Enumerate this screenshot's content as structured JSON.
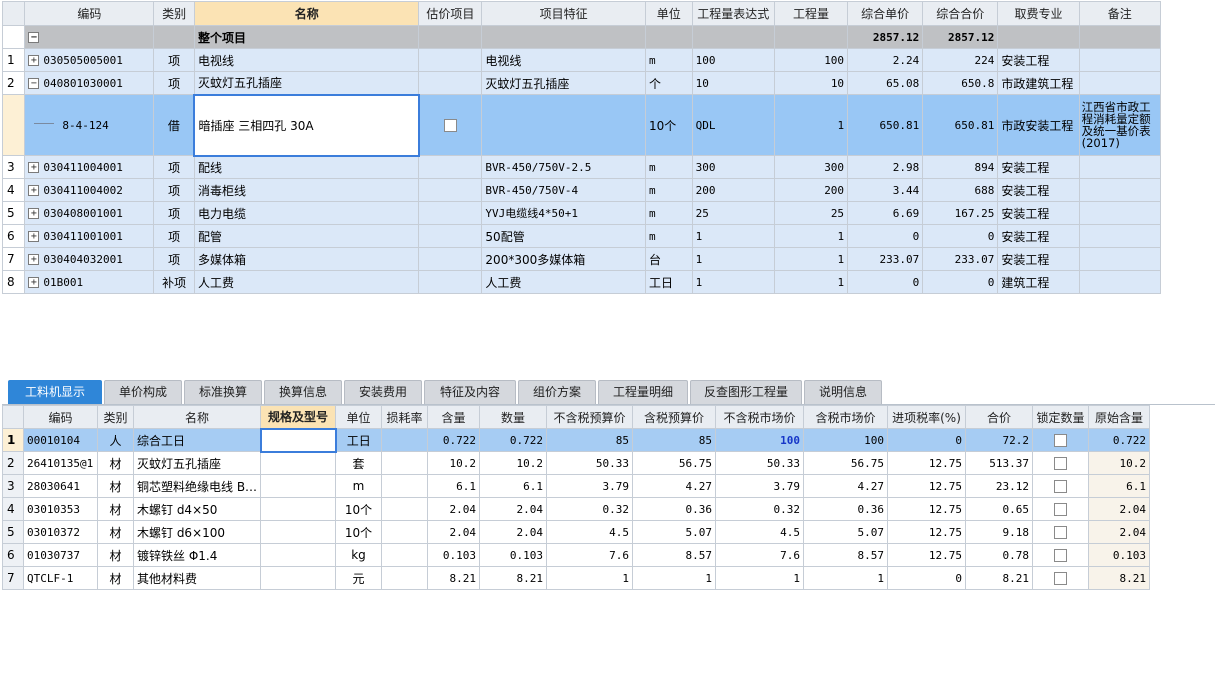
{
  "top": {
    "headers": [
      "编码",
      "类别",
      "名称",
      "估价项目",
      "项目特征",
      "单位",
      "工程量表达式",
      "工程量",
      "综合单价",
      "综合合价",
      "取费专业",
      "备注"
    ],
    "total": {
      "label": "整个项目",
      "unit_price": "2857.12",
      "total_price": "2857.12"
    },
    "rows": [
      {
        "idx": "1",
        "code": "030505005001",
        "type": "项",
        "name": "电视线",
        "feature": "电视线",
        "unit": "m",
        "expr": "100",
        "qty": "100",
        "price": "2.24",
        "total": "224",
        "fee": "安装工程",
        "note": ""
      },
      {
        "idx": "2",
        "code": "040801030001",
        "type": "项",
        "name": "灭蚊灯五孔插座",
        "feature": "灭蚊灯五孔插座",
        "unit": "个",
        "expr": "10",
        "qty": "10",
        "price": "65.08",
        "total": "650.8",
        "fee": "市政建筑工程",
        "note": ""
      }
    ],
    "sub": {
      "code": "8-4-124",
      "type": "借",
      "name": "暗插座 三相四孔 30A",
      "unit": "10个",
      "expr": "QDL",
      "qty": "1",
      "price": "650.81",
      "total": "650.81",
      "fee": "市政安装工程",
      "note": "江西省市政工程消耗量定额及统一基价表(2017)"
    },
    "rows2": [
      {
        "idx": "3",
        "code": "030411004001",
        "type": "项",
        "name": "配线",
        "feature": "BVR-450/750V-2.5",
        "unit": "m",
        "expr": "300",
        "qty": "300",
        "price": "2.98",
        "total": "894",
        "fee": "安装工程",
        "note": ""
      },
      {
        "idx": "4",
        "code": "030411004002",
        "type": "项",
        "name": "消毒柜线",
        "feature": "BVR-450/750V-4",
        "unit": "m",
        "expr": "200",
        "qty": "200",
        "price": "3.44",
        "total": "688",
        "fee": "安装工程",
        "note": ""
      },
      {
        "idx": "5",
        "code": "030408001001",
        "type": "项",
        "name": "电力电缆",
        "feature": "YVJ电缆线4*50+1",
        "unit": "m",
        "expr": "25",
        "qty": "25",
        "price": "6.69",
        "total": "167.25",
        "fee": "安装工程",
        "note": ""
      },
      {
        "idx": "6",
        "code": "030411001001",
        "type": "项",
        "name": "配管",
        "feature": "50配管",
        "unit": "m",
        "expr": "1",
        "qty": "1",
        "price": "0",
        "total": "0",
        "fee": "安装工程",
        "note": ""
      },
      {
        "idx": "7",
        "code": "030404032001",
        "type": "项",
        "name": "多媒体箱",
        "feature": "200*300多媒体箱",
        "unit": "台",
        "expr": "1",
        "qty": "1",
        "price": "233.07",
        "total": "233.07",
        "fee": "安装工程",
        "note": ""
      },
      {
        "idx": "8",
        "code": "01B001",
        "type": "补项",
        "name": "人工费",
        "feature": "人工费",
        "unit": "工日",
        "expr": "1",
        "qty": "1",
        "price": "0",
        "total": "0",
        "fee": "建筑工程",
        "note": ""
      }
    ]
  },
  "tabs": [
    "工料机显示",
    "单价构成",
    "标准换算",
    "换算信息",
    "安装费用",
    "特征及内容",
    "组价方案",
    "工程量明细",
    "反查图形工程量",
    "说明信息"
  ],
  "bottom": {
    "headers": [
      "编码",
      "类别",
      "名称",
      "规格及型号",
      "单位",
      "损耗率",
      "含量",
      "数量",
      "不含税预算价",
      "含税预算价",
      "不含税市场价",
      "含税市场价",
      "进项税率(%)",
      "合价",
      "锁定数量",
      "原始含量"
    ],
    "rows": [
      {
        "idx": "1",
        "code": "00010104",
        "type": "人",
        "name": "综合工日",
        "spec": "",
        "unit": "工日",
        "loss": "",
        "content": "0.722",
        "qty": "0.722",
        "p1": "85",
        "p2": "85",
        "p3": "100",
        "p4": "100",
        "tax": "0",
        "total": "72.2",
        "orig": "0.722"
      },
      {
        "idx": "2",
        "code": "26410135@1",
        "type": "材",
        "name": "灭蚊灯五孔插座",
        "spec": "",
        "unit": "套",
        "loss": "",
        "content": "10.2",
        "qty": "10.2",
        "p1": "50.33",
        "p2": "56.75",
        "p3": "50.33",
        "p4": "56.75",
        "tax": "12.75",
        "total": "513.37",
        "orig": "10.2"
      },
      {
        "idx": "3",
        "code": "28030641",
        "type": "材",
        "name": "铜芯塑料绝缘电线 B…",
        "spec": "",
        "unit": "m",
        "loss": "",
        "content": "6.1",
        "qty": "6.1",
        "p1": "3.79",
        "p2": "4.27",
        "p3": "3.79",
        "p4": "4.27",
        "tax": "12.75",
        "total": "23.12",
        "orig": "6.1"
      },
      {
        "idx": "4",
        "code": "03010353",
        "type": "材",
        "name": "木螺钉 d4×50",
        "spec": "",
        "unit": "10个",
        "loss": "",
        "content": "2.04",
        "qty": "2.04",
        "p1": "0.32",
        "p2": "0.36",
        "p3": "0.32",
        "p4": "0.36",
        "tax": "12.75",
        "total": "0.65",
        "orig": "2.04"
      },
      {
        "idx": "5",
        "code": "03010372",
        "type": "材",
        "name": "木螺钉 d6×100",
        "spec": "",
        "unit": "10个",
        "loss": "",
        "content": "2.04",
        "qty": "2.04",
        "p1": "4.5",
        "p2": "5.07",
        "p3": "4.5",
        "p4": "5.07",
        "tax": "12.75",
        "total": "9.18",
        "orig": "2.04"
      },
      {
        "idx": "6",
        "code": "01030737",
        "type": "材",
        "name": "镀锌铁丝 Φ1.4",
        "spec": "",
        "unit": "kg",
        "loss": "",
        "content": "0.103",
        "qty": "0.103",
        "p1": "7.6",
        "p2": "8.57",
        "p3": "7.6",
        "p4": "8.57",
        "tax": "12.75",
        "total": "0.78",
        "orig": "0.103"
      },
      {
        "idx": "7",
        "code": "QTCLF-1",
        "type": "材",
        "name": "其他材料费",
        "spec": "",
        "unit": "元",
        "loss": "",
        "content": "8.21",
        "qty": "8.21",
        "p1": "1",
        "p2": "1",
        "p3": "1",
        "p4": "1",
        "tax": "0",
        "total": "8.21",
        "orig": "8.21"
      }
    ]
  }
}
